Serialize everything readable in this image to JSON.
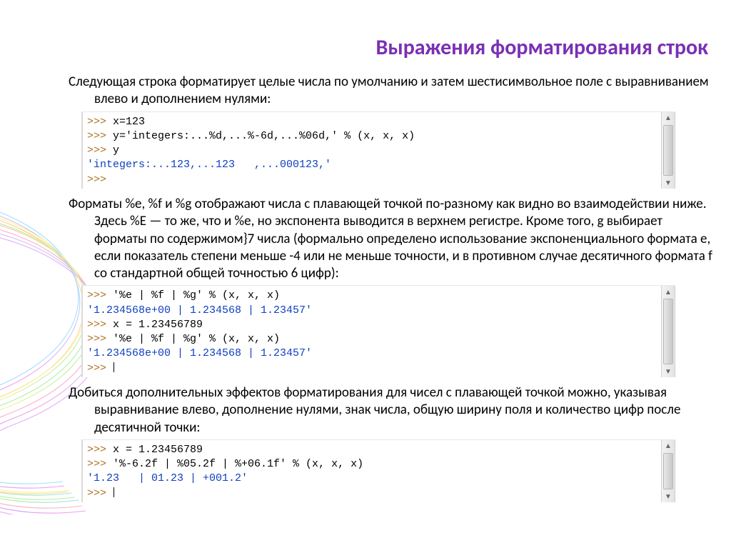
{
  "title": "Выражения форматирования строк",
  "para1": "Следующая строка форматирует целые числа по умолчанию и затем шестисимвольное поле с выравниванием влево и дополнением нулями:",
  "code1": {
    "l1_prompt": ">>> ",
    "l1_code": "x=123",
    "l2_prompt": ">>> ",
    "l2_code": "y='integers:...%d,...%-6d,...%06d,' % (x, x, x)",
    "l3_prompt": ">>> ",
    "l3_code": "y",
    "l4_out": "'integers:...123,...123   ,...000123,'",
    "l5_prompt": ">>>"
  },
  "para2": "Форматы %e, %f и %g отображают числа с плавающей точкой по-разному как видно во взаимодействии ниже. Здесь %E — то же, что и %e, но экспонента выводится в верхнем регистре. Кроме того, g выбирает форматы по содержимом}7 числа (формально определено использование экспоненциального формата e, если показатель степени меньше -4 или не меньше точности, и в противном случае десятичного формата f со стандартной общей точностью 6 цифр):",
  "code2": {
    "l1_prompt": ">>> ",
    "l1_code": "'%e | %f | %g' % (x, x, x)",
    "l2_out": "'1.234568e+00 | 1.234568 | 1.23457'",
    "l3_prompt": ">>> ",
    "l3_code": "x = 1.23456789",
    "l4_prompt": ">>> ",
    "l4_code": "'%e | %f | %g' % (x, x, x)",
    "l5_out": "'1.234568e+00 | 1.234568 | 1.23457'",
    "l6_prompt": ">>> "
  },
  "para3": "Добиться дополнительных эффектов форматирования для чисел с плавающей точкой можно, указывая выравнивание влево, дополнение нулями, знак числа, общую ширину поля и количество цифр после десятичной точки:",
  "code3": {
    "l1_prompt": ">>> ",
    "l1_code": "x = 1.23456789",
    "l2_prompt": ">>> ",
    "l2_code": "'%-6.2f | %05.2f | %+06.1f' % (x, x, x)",
    "l3_out": "'1.23   | 01.23 | +001.2'",
    "l4_prompt": ">>> "
  }
}
